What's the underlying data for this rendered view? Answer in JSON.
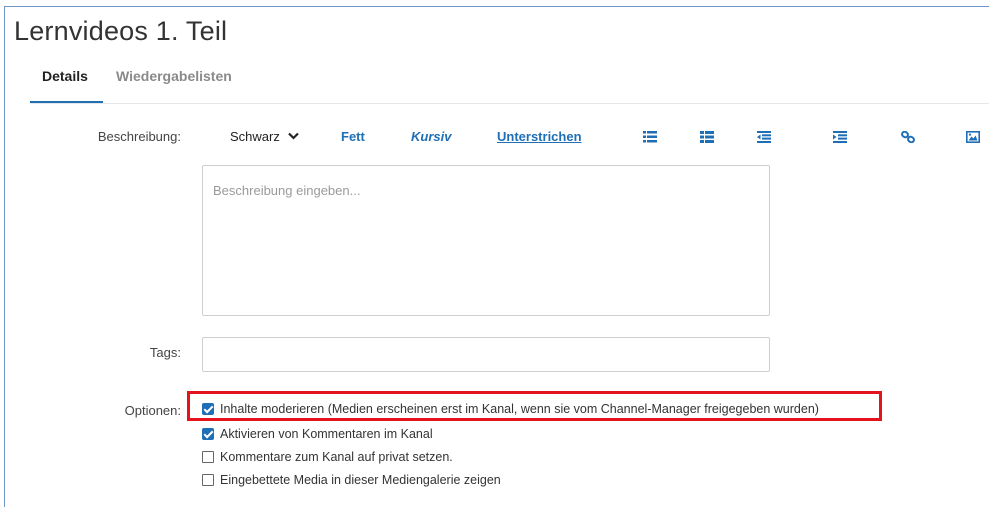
{
  "page": {
    "title": "Lernvideos 1. Teil"
  },
  "tabs": [
    {
      "label": "Details",
      "active": true
    },
    {
      "label": "Wiedergabelisten",
      "active": false
    }
  ],
  "form": {
    "description_label": "Beschreibung:",
    "description_placeholder": "Beschreibung eingeben...",
    "tags_label": "Tags:",
    "options_label": "Optionen:"
  },
  "toolbar": {
    "color_value": "Schwarz",
    "bold_label": "Fett",
    "italic_label": "Kursiv",
    "underline_label": "Unterstrichen",
    "icons": [
      "bulleted-list-icon",
      "numbered-list-icon",
      "outdent-icon",
      "indent-icon",
      "link-icon",
      "image-icon"
    ]
  },
  "options": [
    {
      "label": "Inhalte moderieren (Medien erscheinen erst im Kanal, wenn sie vom Channel-Manager freigegeben wurden)",
      "checked": true,
      "highlighted": true
    },
    {
      "label": "Aktivieren von Kommentaren im Kanal",
      "checked": true
    },
    {
      "label": "Kommentare zum Kanal auf privat setzen.",
      "checked": false
    },
    {
      "label": "Eingebettete Media in dieser Mediengalerie zeigen",
      "checked": false
    }
  ],
  "colors": {
    "accent": "#1f6fb6",
    "highlight": "#e3141b",
    "frame": "#6f94c8"
  }
}
